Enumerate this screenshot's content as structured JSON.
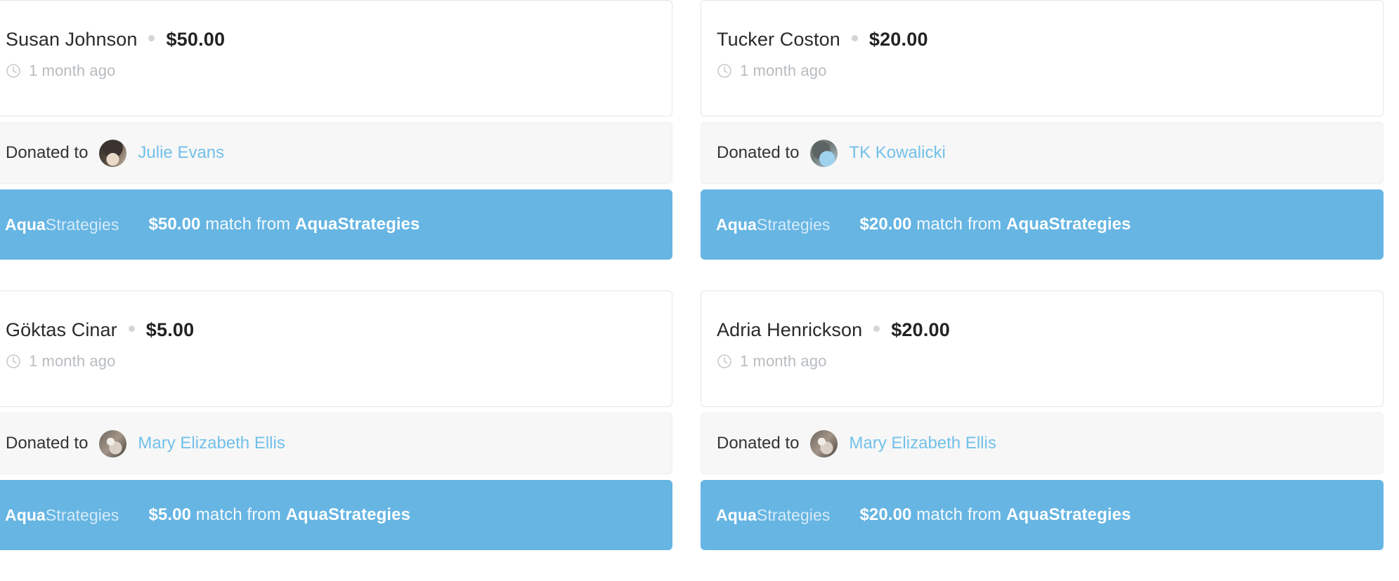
{
  "theme": {
    "match_banner_bg": "#66b5e3",
    "link_color": "#72c0ea",
    "donated_bar_bg": "#f7f7f7",
    "card_bg": "#ffffff",
    "muted_text": "#b8bcc0"
  },
  "labels": {
    "donated_to": "Donated to",
    "match_suffix": "match from"
  },
  "sponsor": {
    "name": "AquaStrategies",
    "logo_bold": "Aqua",
    "logo_light": "Strategies"
  },
  "columns": [
    {
      "side": "left",
      "cards": [
        {
          "donor": "Susan Johnson",
          "amount": "$50.00",
          "time": "1 month ago",
          "donated_to_label": "Donated to",
          "recipient": "Julie Evans",
          "avatar_style": "av-julie",
          "match_logo_bold": "Aqua",
          "match_logo_light": "Strategies",
          "match_amount": "$50.00",
          "match_middle": " match from ",
          "match_sponsor": "AquaStrategies"
        },
        {
          "donor": "Göktas Cinar",
          "amount": "$5.00",
          "time": "1 month ago",
          "donated_to_label": "Donated to",
          "recipient": "Mary Elizabeth Ellis",
          "avatar_style": "av-mary",
          "match_logo_bold": "Aqua",
          "match_logo_light": "Strategies",
          "match_amount": "$5.00",
          "match_middle": " match from ",
          "match_sponsor": "AquaStrategies"
        }
      ]
    },
    {
      "side": "right",
      "cards": [
        {
          "donor": "Tucker Coston",
          "amount": "$20.00",
          "time": "1 month ago",
          "donated_to_label": "Donated to",
          "recipient": "TK Kowalicki",
          "avatar_style": "av-tk",
          "match_logo_bold": "Aqua",
          "match_logo_light": "Strategies",
          "match_amount": "$20.00",
          "match_middle": " match from ",
          "match_sponsor": "AquaStrategies"
        },
        {
          "donor": "Adria Henrickson",
          "amount": "$20.00",
          "time": "1 month ago",
          "donated_to_label": "Donated to",
          "recipient": "Mary Elizabeth Ellis",
          "avatar_style": "av-mary",
          "match_logo_bold": "Aqua",
          "match_logo_light": "Strategies",
          "match_amount": "$20.00",
          "match_middle": " match from ",
          "match_sponsor": "AquaStrategies"
        }
      ]
    }
  ]
}
